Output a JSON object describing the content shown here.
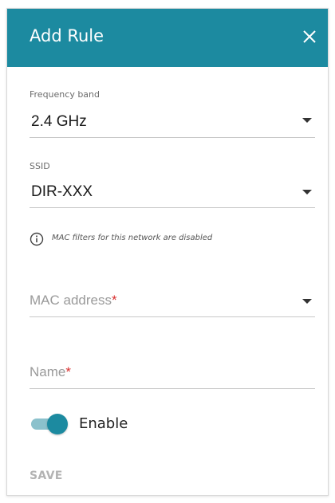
{
  "dialog": {
    "title": "Add Rule",
    "close_icon": "close-icon"
  },
  "fields": {
    "frequency_band": {
      "label": "Frequency band",
      "value": "2.4 GHz"
    },
    "ssid": {
      "label": "SSID",
      "value": "DIR-XXX"
    },
    "mac_address": {
      "placeholder": "MAC address",
      "required_mark": "*"
    },
    "name": {
      "placeholder": "Name",
      "required_mark": "*"
    }
  },
  "info_note": {
    "icon": "info-icon",
    "text": "MAC filters for this network are disabled"
  },
  "enable_toggle": {
    "label": "Enable",
    "state": "on"
  },
  "actions": {
    "save_label": "SAVE"
  },
  "colors": {
    "accent": "#1c8aa0",
    "required": "#d9302f",
    "disabled_text": "#b3b3b3"
  }
}
